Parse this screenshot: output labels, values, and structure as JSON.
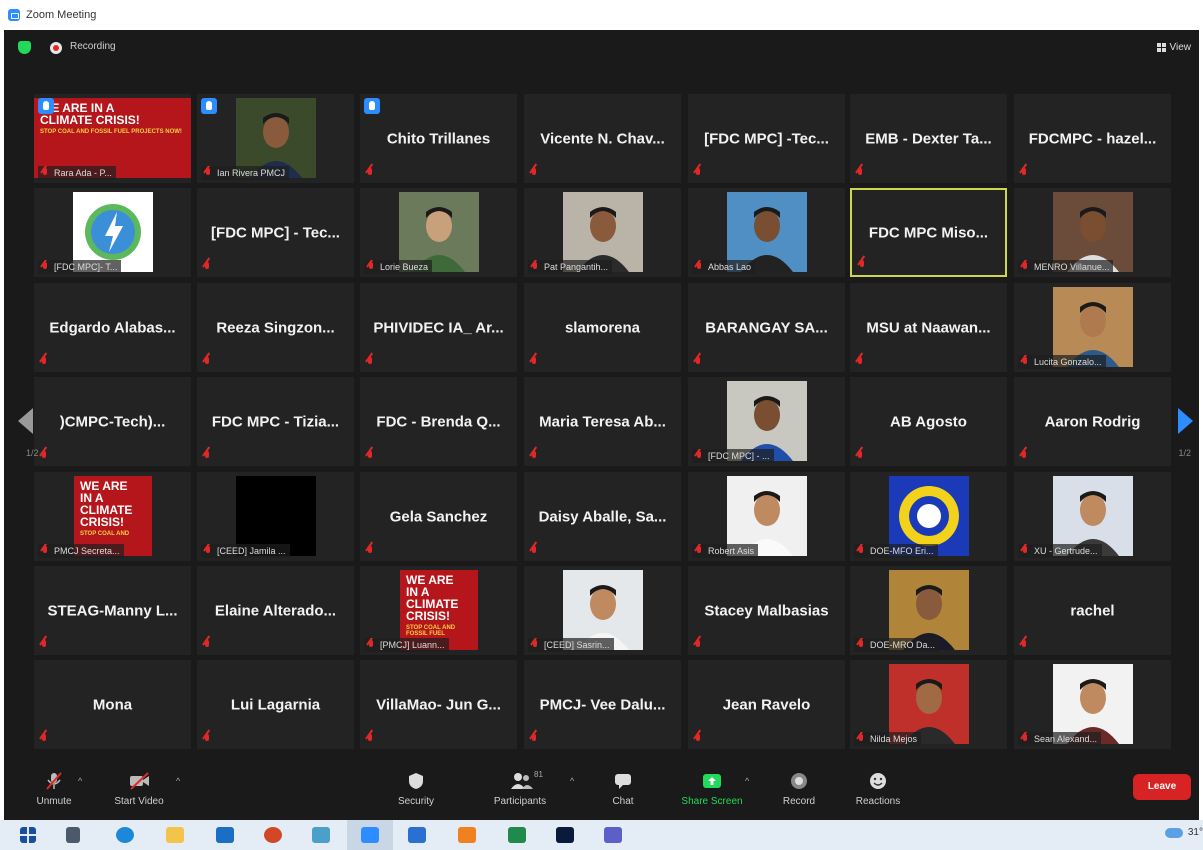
{
  "window": {
    "title": "Zoom Meeting"
  },
  "topbar": {
    "recording_label": "Recording",
    "view_label": "View"
  },
  "pagination": {
    "left": "1/2",
    "right": "1/2"
  },
  "tiles": [
    {
      "kind": "poster",
      "label": "Rara Ada - P...",
      "hand": true,
      "poster": [
        "WE ARE IN A",
        "CLIMATE CRISIS!"
      ],
      "poster_small": "STOP COAL AND FOSSIL FUEL PROJECTS NOW!"
    },
    {
      "kind": "photo",
      "label": "Ian Rivera PMCJ",
      "hand": true,
      "photo": {
        "bg": "#3b4a2a",
        "skin": "#8a5a3c",
        "shirt": "#1e2d4a"
      }
    },
    {
      "kind": "name",
      "name": "Chito Trillanes",
      "hand": true
    },
    {
      "kind": "name",
      "name": "Vicente N. Chav..."
    },
    {
      "kind": "name",
      "name": "[FDC MPC] -Tec..."
    },
    {
      "kind": "name",
      "name": "EMB - Dexter Ta..."
    },
    {
      "kind": "name",
      "name": "FDCMPC - hazel..."
    },
    {
      "kind": "logo",
      "label": "[FDC MPC]- T..."
    },
    {
      "kind": "name",
      "name": "[FDC MPC] - Tec..."
    },
    {
      "kind": "photo",
      "label": "Lorie Bueza",
      "photo": {
        "bg": "#6a7a5a",
        "skin": "#c8a07a",
        "shirt": "#3e6a3a"
      }
    },
    {
      "kind": "photo",
      "label": "Pat Pangantih...",
      "photo": {
        "bg": "#b9b3a8",
        "skin": "#8a5a3c",
        "shirt": "#2b2b2b"
      }
    },
    {
      "kind": "photo",
      "label": "Abbas Lao",
      "photo": {
        "bg": "#4f8fc4",
        "skin": "#7a4e30",
        "shirt": "#222"
      }
    },
    {
      "kind": "name",
      "name": "FDC MPC Miso...",
      "active": true
    },
    {
      "kind": "photo",
      "label": "MENRO Villanue...",
      "photo": {
        "bg": "#6b4b3a",
        "skin": "#7a4e30",
        "shirt": "#ddd"
      }
    },
    {
      "kind": "name",
      "name": "Edgardo Alabas..."
    },
    {
      "kind": "name",
      "name": "Reeza Singzon..."
    },
    {
      "kind": "name",
      "name": "PHIVIDEC IA_ Ar..."
    },
    {
      "kind": "name",
      "name": "slamorena"
    },
    {
      "kind": "name",
      "name": "BARANGAY SA..."
    },
    {
      "kind": "name",
      "name": "MSU at Naawan..."
    },
    {
      "kind": "photo",
      "label": "Lucita Gonzalo...",
      "photo": {
        "bg": "#b88a55",
        "skin": "#b07a50",
        "shirt": "#2d5a8a"
      }
    },
    {
      "kind": "name",
      "name": ")CMPC-Tech)..."
    },
    {
      "kind": "name",
      "name": "FDC MPC - Tizia..."
    },
    {
      "kind": "name",
      "name": "FDC - Brenda Q..."
    },
    {
      "kind": "name",
      "name": "Maria Teresa Ab..."
    },
    {
      "kind": "photo",
      "label": "[FDC MPC] - ...",
      "photo": {
        "bg": "#c8c8c0",
        "skin": "#7a4e30",
        "shirt": "#1f4fa8"
      }
    },
    {
      "kind": "name",
      "name": "AB Agosto"
    },
    {
      "kind": "name",
      "name": "Aaron Rodrig"
    },
    {
      "kind": "poster",
      "label": "PMCJ Secreta...",
      "poster": [
        "WE ARE",
        "IN A",
        "CLIMATE",
        "CRISIS!"
      ],
      "poster_small": "STOP COAL AND"
    },
    {
      "kind": "black",
      "label": "[CEED] Jamila ..."
    },
    {
      "kind": "name",
      "name": "Gela Sanchez"
    },
    {
      "kind": "name",
      "name": "Daisy Aballe, Sa..."
    },
    {
      "kind": "photo",
      "label": "Robert Asis",
      "photo": {
        "bg": "#f0f0f0",
        "skin": "#c08a60",
        "shirt": "#fafafa"
      }
    },
    {
      "kind": "seal",
      "label": "DOE-MFO Eri..."
    },
    {
      "kind": "photo",
      "label": "XU - Gertrude...",
      "photo": {
        "bg": "#d8dfe8",
        "skin": "#c08a60",
        "shirt": "#3a3a3a"
      }
    },
    {
      "kind": "name",
      "name": "STEAG-Manny L..."
    },
    {
      "kind": "name",
      "name": "Elaine Alterado..."
    },
    {
      "kind": "poster",
      "label": "[PMCJ] Luann...",
      "poster": [
        "WE ARE",
        "IN A",
        "CLIMATE",
        "CRISIS!"
      ],
      "poster_small": "STOP COAL AND FOSSIL FUEL"
    },
    {
      "kind": "photo",
      "label": "[CEED] Sasrin...",
      "photo": {
        "bg": "#e4e8ea",
        "skin": "#c08a60",
        "shirt": "#f5f5f5"
      }
    },
    {
      "kind": "name",
      "name": "Stacey Malbasias"
    },
    {
      "kind": "photo",
      "label": "DOE-MRO Da...",
      "photo": {
        "bg": "#b0853a",
        "skin": "#8a5a3c",
        "shirt": "#1a1a2a"
      }
    },
    {
      "kind": "name",
      "name": "rachel"
    },
    {
      "kind": "name",
      "name": "Mona"
    },
    {
      "kind": "name",
      "name": "Lui Lagarnia"
    },
    {
      "kind": "name",
      "name": "VillaMao- Jun G..."
    },
    {
      "kind": "name",
      "name": "PMCJ- Vee Dalu..."
    },
    {
      "kind": "name",
      "name": "Jean Ravelo"
    },
    {
      "kind": "photo",
      "label": "Nilda Mejos",
      "photo": {
        "bg": "#c0302a",
        "skin": "#a06a45",
        "shirt": "#2a2a2a"
      }
    },
    {
      "kind": "photo",
      "label": "Sean Alexand...",
      "photo": {
        "bg": "#f2f2f2",
        "skin": "#c08a60",
        "shirt": "#6a2a2a"
      }
    }
  ],
  "toolbar": {
    "unmute": "Unmute",
    "start_video": "Start Video",
    "security": "Security",
    "participants": "Participants",
    "participants_count": "81",
    "chat": "Chat",
    "share_screen": "Share Screen",
    "record": "Record",
    "reactions": "Reactions",
    "leave": "Leave"
  },
  "taskbar": {
    "temperature": "31°"
  },
  "colors": {
    "accent_blue": "#2D8CFF",
    "share_green": "#23D959",
    "leave_red": "#D72323",
    "muted_red": "#E02828",
    "active_border": "#C9D94A"
  }
}
